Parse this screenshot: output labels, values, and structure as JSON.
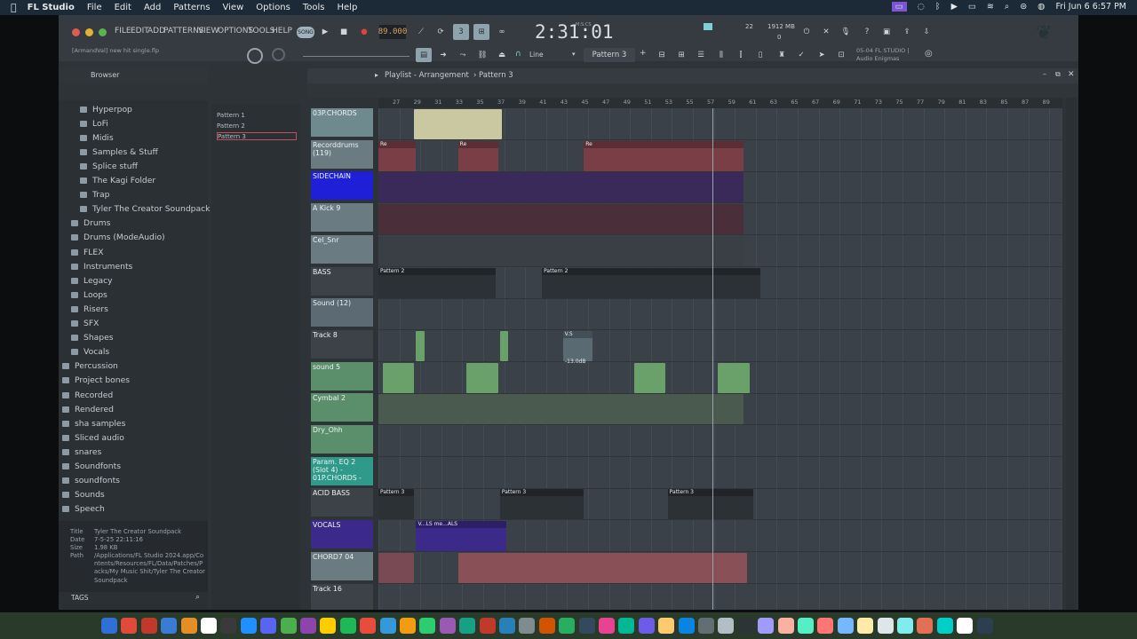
{
  "macbar": {
    "app": "FL Studio",
    "menus": [
      "File",
      "Edit",
      "Add",
      "Patterns",
      "View",
      "Options",
      "Tools",
      "Help"
    ],
    "datetime": "Fri Jun 6  6:57 PM"
  },
  "fl": {
    "menus": [
      "FILE",
      "EDIT",
      "ADD",
      "PATTERNS",
      "VIEW",
      "OPTIONS",
      "TOOLS",
      "HELP"
    ],
    "song_badge": "SONG",
    "bpm": "89.000",
    "time": "2:31:01",
    "time_unit": "M:S:CS",
    "cpu": "22",
    "mem": "1912 MB",
    "mem2": "0",
    "project_hint": "[ArmandVal] new hit single.flp",
    "snap": "Line",
    "pattern_selector": "Pattern 3",
    "news_line1": "05-04  FL STUDIO |",
    "news_line2": "Audio Enigmas"
  },
  "browser": {
    "title": "Browser",
    "items": [
      {
        "label": "Hyperpop",
        "indent": 1
      },
      {
        "label": "LoFi",
        "indent": 1
      },
      {
        "label": "Midis",
        "indent": 1
      },
      {
        "label": "Samples & Stuff",
        "indent": 1
      },
      {
        "label": "Splice stuff",
        "indent": 1
      },
      {
        "label": "The Kagi Folder",
        "indent": 1
      },
      {
        "label": "Trap",
        "indent": 1
      },
      {
        "label": "Tyler The Creator Soundpack",
        "indent": 1
      },
      {
        "label": "Drums",
        "indent": 0
      },
      {
        "label": "Drums (ModeAudio)",
        "indent": 0
      },
      {
        "label": "FLEX",
        "indent": 0
      },
      {
        "label": "Instruments",
        "indent": 0
      },
      {
        "label": "Legacy",
        "indent": 0
      },
      {
        "label": "Loops",
        "indent": 0
      },
      {
        "label": "Risers",
        "indent": 0
      },
      {
        "label": "SFX",
        "indent": 0
      },
      {
        "label": "Shapes",
        "indent": 0
      },
      {
        "label": "Vocals",
        "indent": 0
      },
      {
        "label": "Percussion",
        "indent": -1
      },
      {
        "label": "Project bones",
        "indent": -1
      },
      {
        "label": "Recorded",
        "indent": -1
      },
      {
        "label": "Rendered",
        "indent": -1
      },
      {
        "label": "sha samples",
        "indent": -1
      },
      {
        "label": "Sliced audio",
        "indent": -1
      },
      {
        "label": "snares",
        "indent": -1
      },
      {
        "label": "Soundfonts",
        "indent": -1
      },
      {
        "label": "soundfonts",
        "indent": -1
      },
      {
        "label": "Sounds",
        "indent": -1
      },
      {
        "label": "Speech",
        "indent": -1
      }
    ],
    "info": {
      "title_label": "Title",
      "title": "Tyler The Creator Soundpack",
      "date_label": "Date",
      "date": "7-5-25 22:11:16",
      "size_label": "Size",
      "size": "1.98 KB",
      "path_label": "Path",
      "path": "/Applications/FL Studio 2024.app/Contents/Resources/FL/Data/Patches/Packs/My Music Shit/Tyler The Creator Soundpack"
    },
    "tags": "TAGS"
  },
  "patterns": [
    "Pattern 1",
    "Pattern 2",
    "Pattern 3"
  ],
  "playlist": {
    "title": "Playlist - Arrangement",
    "current_pattern": "Pattern 3",
    "ruler": [
      "27",
      "29",
      "31",
      "33",
      "35",
      "37",
      "39",
      "41",
      "43",
      "45",
      "47",
      "49",
      "51",
      "53",
      "55",
      "57",
      "59",
      "61",
      "63",
      "65",
      "67",
      "69",
      "71",
      "73",
      "75",
      "77",
      "79",
      "81",
      "83",
      "85",
      "87",
      "89"
    ],
    "tracks": [
      {
        "name": "03P.CHORDS",
        "color": "#6f8a8e"
      },
      {
        "name": "Recorddrums (119)",
        "color": "#6a7b82"
      },
      {
        "name": "SIDECHAIN",
        "color": "#1f1fd8"
      },
      {
        "name": "A Kick 9",
        "color": "#6a7b82"
      },
      {
        "name": "Cel_Snr",
        "color": "#6a7b82"
      },
      {
        "name": "BASS",
        "color": "#3c4247"
      },
      {
        "name": "Sound (12)",
        "color": "#5b6a73"
      },
      {
        "name": "Track 8",
        "color": "#3c4247"
      },
      {
        "name": "sound 5",
        "color": "#5b8f6c"
      },
      {
        "name": "Cymbal 2",
        "color": "#5b8f6c"
      },
      {
        "name": "Dry_Ohh",
        "color": "#5b8f6c"
      },
      {
        "name": "Param. EQ 2 (Slot 4) - 01P.CHORDS -",
        "color": "#2f9a8a"
      },
      {
        "name": "ACID BASS",
        "color": "#3c4247"
      },
      {
        "name": "VOCALS",
        "color": "#3b2a8a"
      },
      {
        "name": "CHORD7 04",
        "color": "#6a7b82"
      },
      {
        "name": "Track 16",
        "color": "#3c4247"
      }
    ],
    "clip_labels": {
      "rec": "Re",
      "pattern1": "Pattern 1",
      "pattern2": "Pattern 2",
      "pattern3": "Pattern 3",
      "vs": "V.S",
      "volume": "-13.0dB",
      "vocals": "V...LS  me...ALS"
    }
  }
}
